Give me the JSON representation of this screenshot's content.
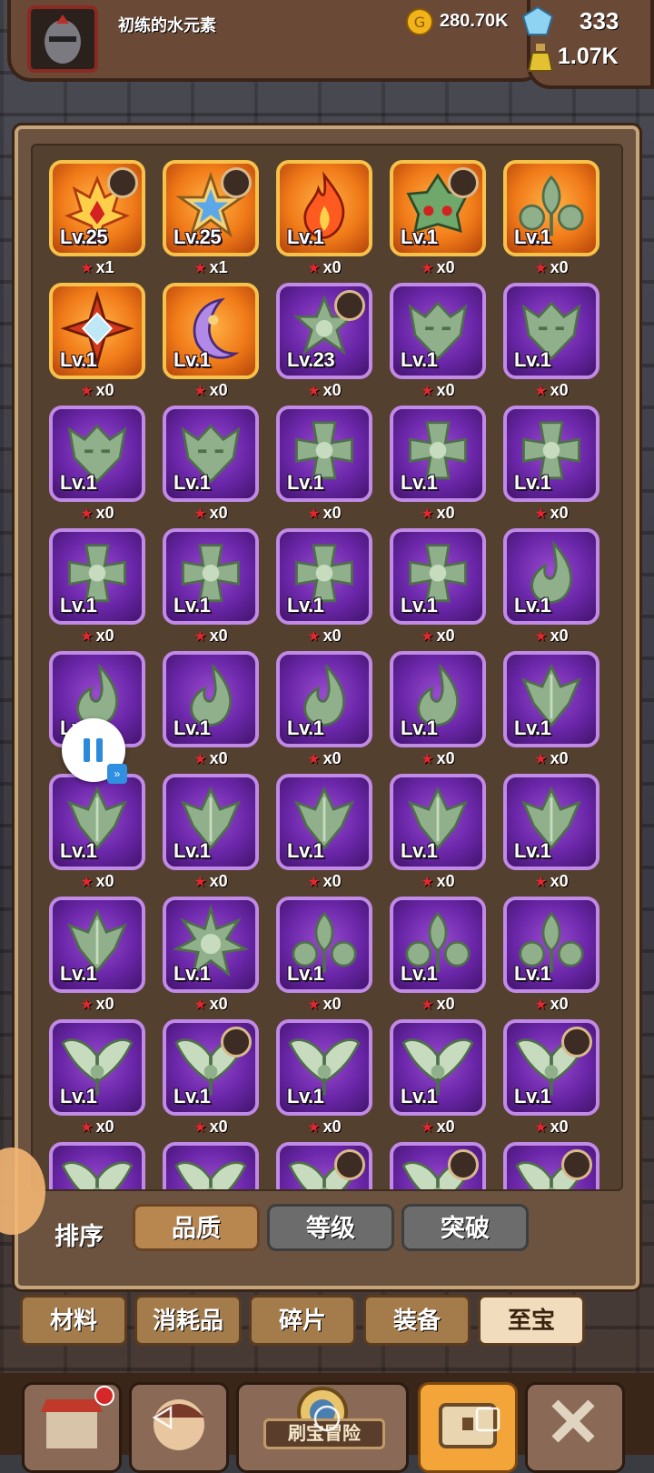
{
  "header": {
    "player_name": "初练的水元素",
    "gold": "280.70K",
    "gems": "333",
    "potion": "1.07K"
  },
  "items": [
    {
      "level": "Lv.25",
      "count": "x1",
      "rarity": "orange",
      "art": "flame-crown",
      "badge": true
    },
    {
      "level": "Lv.25",
      "count": "x1",
      "rarity": "orange",
      "art": "blue-star",
      "badge": true
    },
    {
      "level": "Lv.1",
      "count": "x0",
      "rarity": "orange",
      "art": "fire",
      "badge": false
    },
    {
      "level": "Lv.1",
      "count": "x0",
      "rarity": "orange",
      "art": "green-helm",
      "badge": true
    },
    {
      "level": "Lv.1",
      "count": "x0",
      "rarity": "orange",
      "art": "green-flower",
      "badge": false
    },
    {
      "level": "Lv.1",
      "count": "x0",
      "rarity": "orange",
      "art": "diamond-star",
      "badge": false
    },
    {
      "level": "Lv.1",
      "count": "x0",
      "rarity": "orange",
      "art": "moon",
      "badge": false
    },
    {
      "level": "Lv.23",
      "count": "x0",
      "rarity": "purple",
      "art": "jade-star",
      "badge": true
    },
    {
      "level": "Lv.1",
      "count": "x0",
      "rarity": "purple",
      "art": "mask",
      "badge": false
    },
    {
      "level": "Lv.1",
      "count": "x0",
      "rarity": "purple",
      "art": "mask",
      "badge": false
    },
    {
      "level": "Lv.1",
      "count": "x0",
      "rarity": "purple",
      "art": "mask",
      "badge": false
    },
    {
      "level": "Lv.1",
      "count": "x0",
      "rarity": "purple",
      "art": "mask",
      "badge": false
    },
    {
      "level": "Lv.1",
      "count": "x0",
      "rarity": "purple",
      "art": "cross",
      "badge": false
    },
    {
      "level": "Lv.1",
      "count": "x0",
      "rarity": "purple",
      "art": "cross",
      "badge": false
    },
    {
      "level": "Lv.1",
      "count": "x0",
      "rarity": "purple",
      "art": "cross",
      "badge": false
    },
    {
      "level": "Lv.1",
      "count": "x0",
      "rarity": "purple",
      "art": "cross",
      "badge": false
    },
    {
      "level": "Lv.1",
      "count": "x0",
      "rarity": "purple",
      "art": "cross",
      "badge": false
    },
    {
      "level": "Lv.1",
      "count": "x0",
      "rarity": "purple",
      "art": "cross",
      "badge": false
    },
    {
      "level": "Lv.1",
      "count": "x0",
      "rarity": "purple",
      "art": "cross",
      "badge": false
    },
    {
      "level": "Lv.1",
      "count": "x0",
      "rarity": "purple",
      "art": "leaf-flame",
      "badge": false
    },
    {
      "level": "Lv.1",
      "count": "x0",
      "rarity": "purple",
      "art": "leaf-flame",
      "badge": false
    },
    {
      "level": "Lv.1",
      "count": "x0",
      "rarity": "purple",
      "art": "leaf-flame",
      "badge": false
    },
    {
      "level": "Lv.1",
      "count": "x0",
      "rarity": "purple",
      "art": "leaf-flame",
      "badge": false
    },
    {
      "level": "Lv.1",
      "count": "x0",
      "rarity": "purple",
      "art": "leaf-flame",
      "badge": false
    },
    {
      "level": "Lv.1",
      "count": "x0",
      "rarity": "purple",
      "art": "horned",
      "badge": false
    },
    {
      "level": "Lv.1",
      "count": "x0",
      "rarity": "purple",
      "art": "horned",
      "badge": false
    },
    {
      "level": "Lv.1",
      "count": "x0",
      "rarity": "purple",
      "art": "horned",
      "badge": false
    },
    {
      "level": "Lv.1",
      "count": "x0",
      "rarity": "purple",
      "art": "horned",
      "badge": false
    },
    {
      "level": "Lv.1",
      "count": "x0",
      "rarity": "purple",
      "art": "horned",
      "badge": false
    },
    {
      "level": "Lv.1",
      "count": "x0",
      "rarity": "purple",
      "art": "horned",
      "badge": false
    },
    {
      "level": "Lv.1",
      "count": "x0",
      "rarity": "purple",
      "art": "horned",
      "badge": false
    },
    {
      "level": "Lv.1",
      "count": "x0",
      "rarity": "purple",
      "art": "spiky-star",
      "badge": false
    },
    {
      "level": "Lv.1",
      "count": "x0",
      "rarity": "purple",
      "art": "green-flower",
      "badge": false
    },
    {
      "level": "Lv.1",
      "count": "x0",
      "rarity": "purple",
      "art": "green-flower",
      "badge": false
    },
    {
      "level": "Lv.1",
      "count": "x0",
      "rarity": "purple",
      "art": "green-flower",
      "badge": false
    },
    {
      "level": "Lv.1",
      "count": "x0",
      "rarity": "purple",
      "art": "wings",
      "badge": false
    },
    {
      "level": "Lv.1",
      "count": "x0",
      "rarity": "purple",
      "art": "wings",
      "badge": true
    },
    {
      "level": "Lv.1",
      "count": "x0",
      "rarity": "purple",
      "art": "wings",
      "badge": false
    },
    {
      "level": "Lv.1",
      "count": "x0",
      "rarity": "purple",
      "art": "wings",
      "badge": false
    },
    {
      "level": "Lv.1",
      "count": "x0",
      "rarity": "purple",
      "art": "wings",
      "badge": true
    },
    {
      "level": "",
      "count": "",
      "rarity": "purple",
      "art": "wings",
      "badge": false
    },
    {
      "level": "",
      "count": "",
      "rarity": "purple",
      "art": "wings",
      "badge": false
    },
    {
      "level": "",
      "count": "",
      "rarity": "purple",
      "art": "wings",
      "badge": true
    },
    {
      "level": "",
      "count": "",
      "rarity": "purple",
      "art": "wings",
      "badge": true
    },
    {
      "level": "",
      "count": "",
      "rarity": "purple",
      "art": "wings",
      "badge": true
    }
  ],
  "sort": {
    "label": "排序",
    "options": [
      "品质",
      "等级",
      "突破"
    ],
    "active": "品质"
  },
  "categories": {
    "tabs": [
      "材料",
      "消耗品",
      "碎片",
      "装备",
      "至宝"
    ],
    "active": "至宝"
  },
  "bottom_nav": {
    "center_label": "刷宝冒险",
    "buttons": [
      "shop-icon",
      "hero-icon",
      "adventure-icon",
      "chest-icon",
      "forge-icon"
    ],
    "active": "chest-icon"
  },
  "colors": {
    "orange_tile": "#f07a18",
    "purple_tile": "#6a26a8",
    "active_sort": "#b8864f",
    "inactive_sort": "#6c6c6c",
    "active_category": "#f1ddbd"
  }
}
